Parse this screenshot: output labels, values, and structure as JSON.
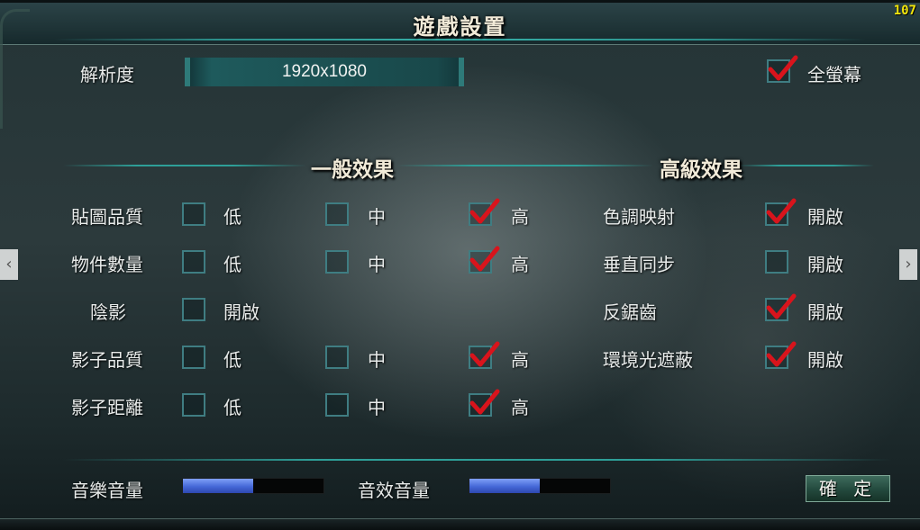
{
  "title": "遊戲設置",
  "fps": "107",
  "resolution": {
    "label": "解析度",
    "value": "1920x1080"
  },
  "fullscreen": {
    "label": "全螢幕",
    "checked": true
  },
  "sections": {
    "general": "一般效果",
    "advanced": "高級效果"
  },
  "levels": {
    "low": "低",
    "mid": "中",
    "high": "高"
  },
  "general": [
    {
      "label": "貼圖品質",
      "selected": "high"
    },
    {
      "label": "物件數量",
      "selected": "high"
    },
    {
      "label": "陰影",
      "option": "開啟",
      "checked": false
    },
    {
      "label": "影子品質",
      "selected": "high"
    },
    {
      "label": "影子距離",
      "selected": "high"
    }
  ],
  "advanced": [
    {
      "label": "色調映射",
      "option": "開啟",
      "checked": true
    },
    {
      "label": "垂直同步",
      "option": "開啟",
      "checked": false
    },
    {
      "label": "反鋸齒",
      "option": "開啟",
      "checked": true
    },
    {
      "label": "環境光遮蔽",
      "option": "開啟",
      "checked": true
    }
  ],
  "audio": {
    "music": {
      "label": "音樂音量",
      "level": 0.5
    },
    "sfx": {
      "label": "音效音量",
      "level": 0.5
    }
  },
  "confirm_label": "確 定",
  "nav": {
    "prev": "‹",
    "next": "›"
  },
  "colors": {
    "check": "#d8141c",
    "accent": "#2e9f98",
    "slider": "#4568d8"
  }
}
